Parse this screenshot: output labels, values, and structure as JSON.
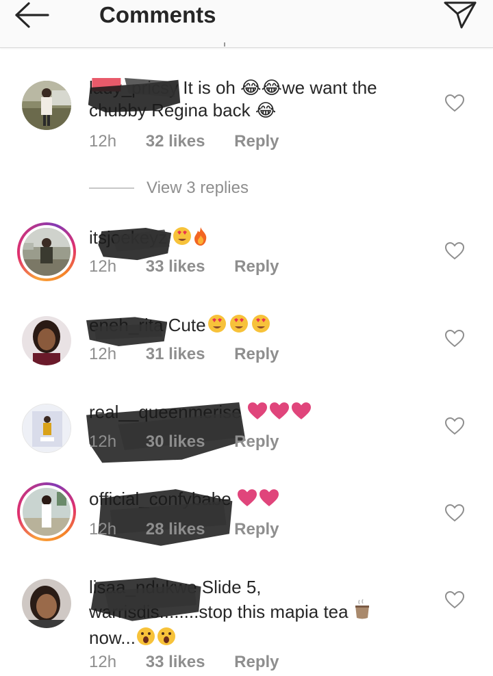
{
  "header": {
    "title": "Comments",
    "back_icon": "arrow-left-icon",
    "send_icon": "paper-plane-icon"
  },
  "comments": [
    {
      "username": "lady_pricsy",
      "text": " It is oh 😂😂we want the chubby Regina back 😂",
      "time": "12h",
      "likes": "32 likes",
      "reply": "Reply",
      "story_ring": false
    },
    {
      "username": "itsjoekeyz",
      "text": "",
      "emoji": [
        "heart-eyes",
        "fire"
      ],
      "time": "12h",
      "likes": "33 likes",
      "reply": "Reply",
      "story_ring": true
    },
    {
      "username": "eneh_rita",
      "text": " Cute",
      "emoji": [
        "heart-eyes",
        "heart-eyes",
        "heart-eyes"
      ],
      "time": "12h",
      "likes": "31 likes",
      "reply": "Reply",
      "story_ring": false
    },
    {
      "username": "real__queenmerise",
      "text": " ",
      "emoji": [
        "pink-heart",
        "pink-heart",
        "pink-heart"
      ],
      "time": "12h",
      "likes": "30 likes",
      "reply": "Reply",
      "story_ring": false
    },
    {
      "username": "official_confybabe",
      "text": " ",
      "emoji": [
        "pink-heart",
        "pink-heart"
      ],
      "time": "12h",
      "likes": "28 likes",
      "reply": "Reply",
      "story_ring": true
    },
    {
      "username": "lisaa_ndukwe",
      "text_1": " Slide 5,",
      "text_2": "warrisdis........stop this mapia tea ",
      "text_3": "now...",
      "emoji_tea": [
        "tea"
      ],
      "emoji_tail": [
        "open-mouth",
        "open-mouth"
      ],
      "time": "12h",
      "likes": "33 likes",
      "reply": "Reply",
      "story_ring": false
    }
  ],
  "replies_link": "View 3 replies",
  "colors": {
    "text": "#262626",
    "meta": "#8e8e8e",
    "heart_pink": "#e0457b",
    "redaction": "#1a1a1a"
  }
}
